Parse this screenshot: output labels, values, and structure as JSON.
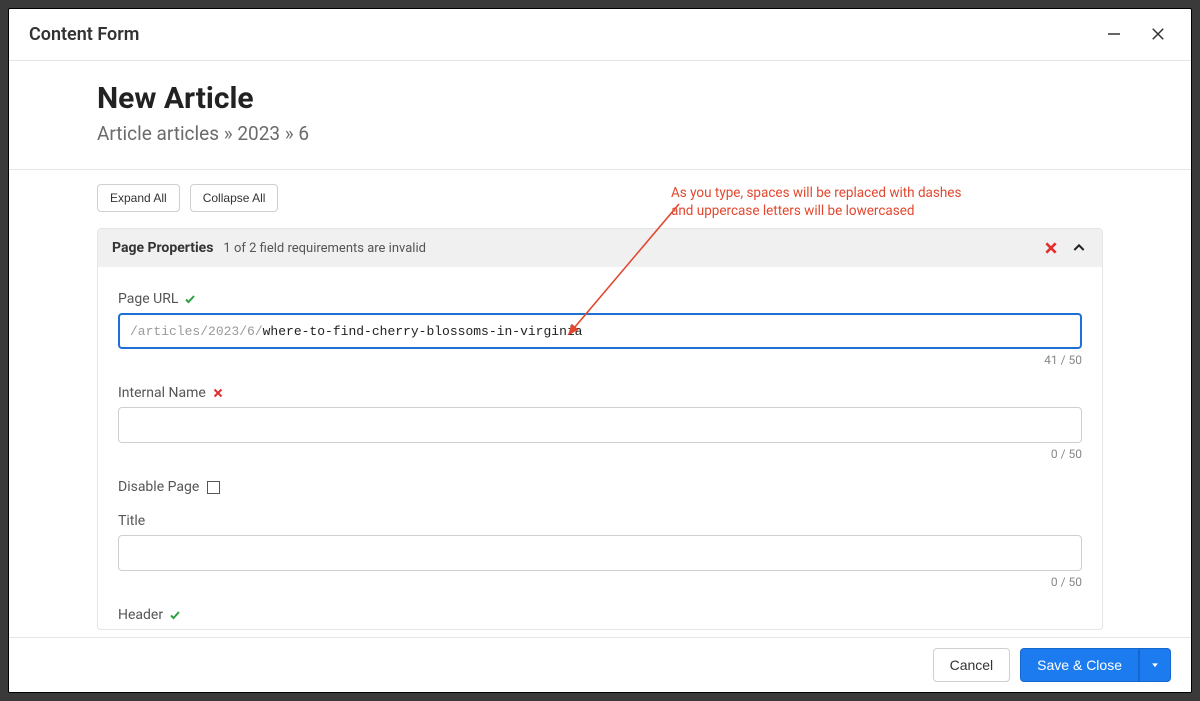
{
  "modal": {
    "title": "Content Form"
  },
  "page": {
    "title": "New Article",
    "breadcrumb": "Article  articles » 2023 » 6"
  },
  "controls": {
    "expand_all": "Expand All",
    "collapse_all": "Collapse All"
  },
  "annotation": {
    "text": "As you type, spaces will be replaced with dashes and uppercase letters will be  lowercased",
    "color": "#e2472f"
  },
  "panel": {
    "title": "Page Properties",
    "subtitle": "1 of 2 field requirements are invalid"
  },
  "fields": {
    "page_url": {
      "label": "Page URL",
      "status": "valid",
      "prefix": "/articles/2023/6/",
      "value": "where-to-find-cherry-blossoms-in-virginia",
      "counter": "41 / 50"
    },
    "internal_name": {
      "label": "Internal Name",
      "status": "invalid",
      "value": "",
      "counter": "0 / 50"
    },
    "disable_page": {
      "label": "Disable Page",
      "checked": false
    },
    "title": {
      "label": "Title",
      "value": "",
      "counter": "0 / 50"
    },
    "header": {
      "label": "Header",
      "status": "valid"
    }
  },
  "footer": {
    "cancel": "Cancel",
    "save_close": "Save & Close"
  }
}
